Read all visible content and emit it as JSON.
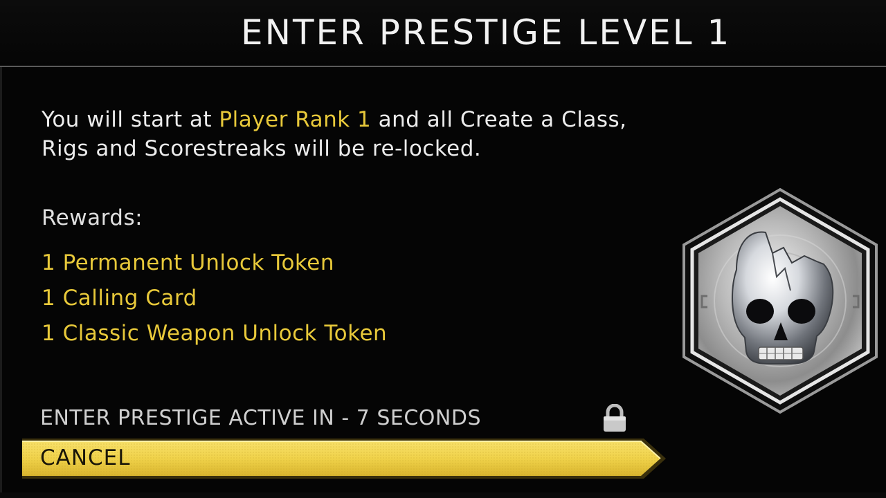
{
  "header": {
    "title": "ENTER PRESTIGE LEVEL 1"
  },
  "description": {
    "prefix": "You will start at ",
    "highlight": "Player Rank 1",
    "suffix": " and all Create a Class, Rigs and Scorestreaks will be re-locked."
  },
  "rewards": {
    "heading": "Rewards:",
    "items": [
      "1 Permanent Unlock Token",
      "1 Calling Card",
      "1 Classic Weapon Unlock Token"
    ]
  },
  "countdown": {
    "text": "ENTER PRESTIGE ACTIVE IN - 7 SECONDS"
  },
  "actions": {
    "cancel_label": "CANCEL"
  },
  "icons": {
    "lock": "lock-icon",
    "emblem": "prestige-skull-emblem"
  },
  "colors": {
    "accent": "#e8c93a",
    "button_fill": "#f3d64c",
    "text_primary": "#ececec",
    "background": "#050505"
  }
}
